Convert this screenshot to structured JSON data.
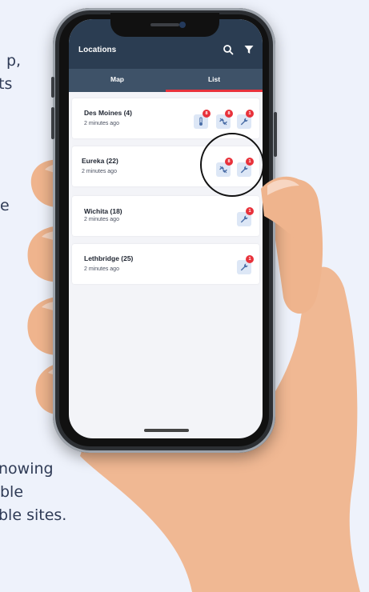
{
  "background": {
    "top_text": [
      "p,",
      "ts"
    ],
    "mid_text": [
      "e"
    ],
    "bottom_text": [
      "nowing",
      "ble",
      "ble sites."
    ]
  },
  "app": {
    "title": "Locations",
    "icons": [
      "search-icon",
      "filter-icon"
    ],
    "tabs": [
      {
        "label": "Map",
        "active": false
      },
      {
        "label": "List",
        "active": true
      }
    ]
  },
  "locations": [
    {
      "name": "Des Moines (4)",
      "time": "2 minutes ago",
      "alerts": [
        {
          "icon": "thermometer-icon",
          "count": "8"
        },
        {
          "icon": "broken-link-icon",
          "count": "8"
        },
        {
          "icon": "wrench-icon",
          "count": "1"
        }
      ]
    },
    {
      "name": "Eureka (22)",
      "time": "2 minutes ago",
      "alerts": [
        {
          "icon": "broken-link-icon",
          "count": "8"
        },
        {
          "icon": "wrench-icon",
          "count": "1"
        }
      ]
    },
    {
      "name": "Wichita (18)",
      "time": "2 minutes ago",
      "alerts": [
        {
          "icon": "wrench-icon",
          "count": "1"
        }
      ]
    },
    {
      "name": "Lethbridge (25)",
      "time": "2 minutes ago",
      "alerts": [
        {
          "icon": "wrench-icon",
          "count": "1"
        }
      ]
    }
  ],
  "colors": {
    "header": "#2b3d52",
    "tab_bar": "#3e5268",
    "accent": "#e8323b",
    "chip_bg": "#dde7f6",
    "icon": "#4b6fa8"
  }
}
